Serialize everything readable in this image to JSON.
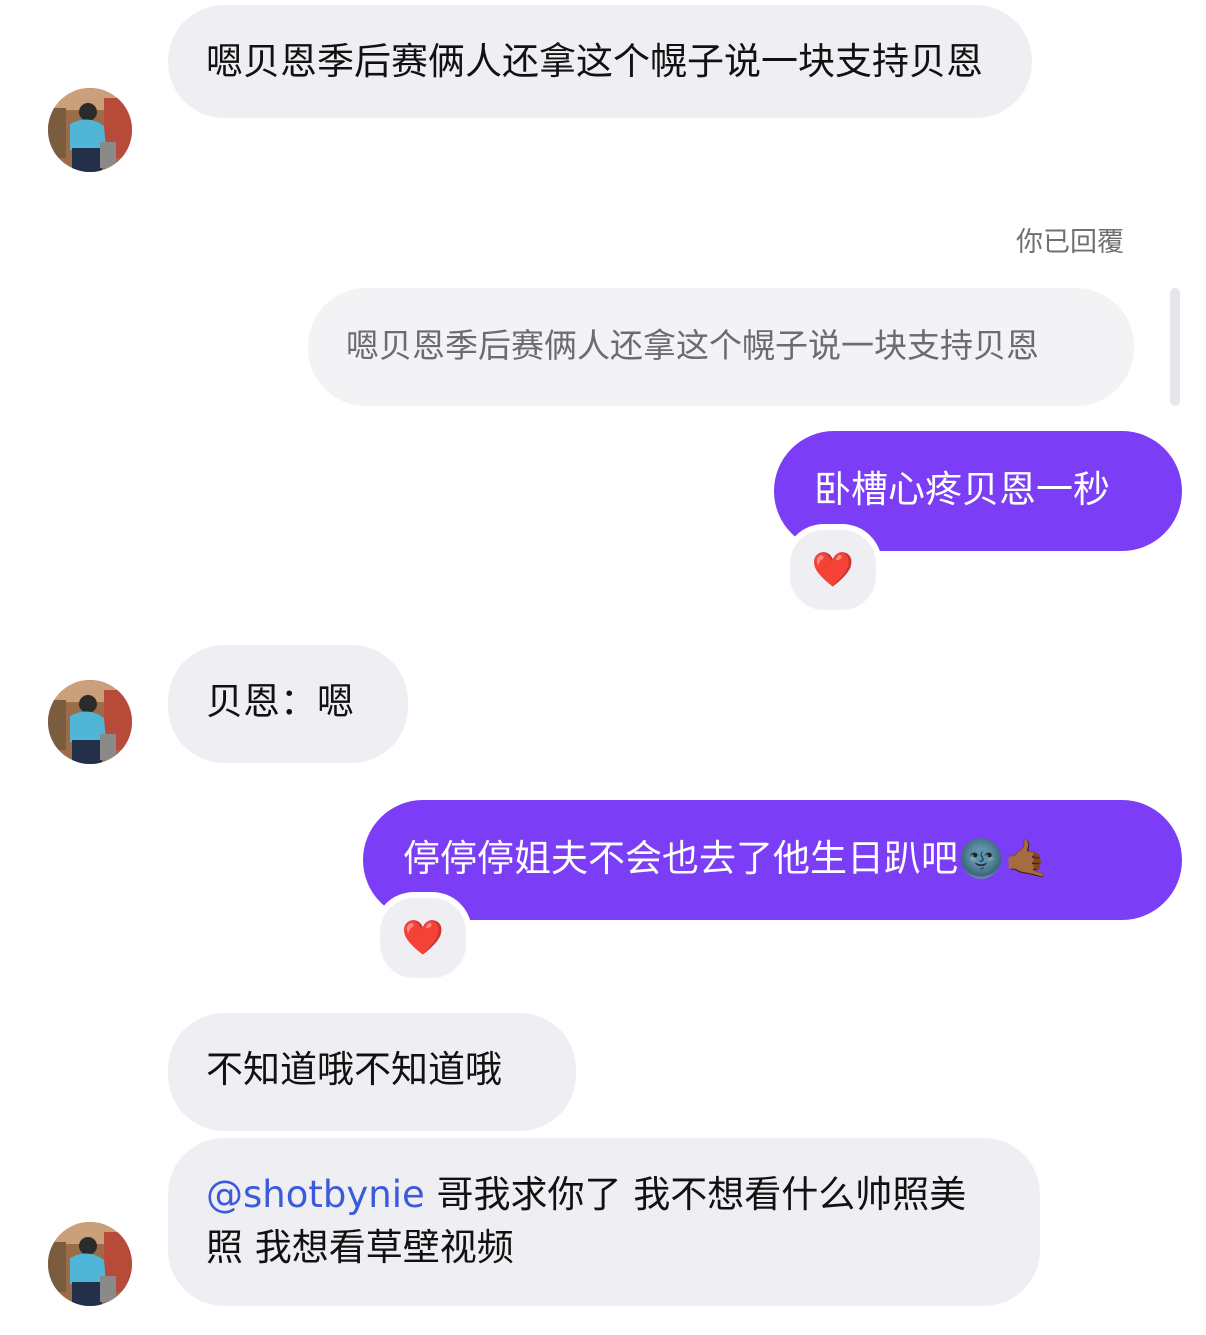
{
  "messages": {
    "m1": {
      "text": "嗯贝恩季后赛俩人还拿这个幌子说一块支持贝恩"
    },
    "reply_status": "你已回覆",
    "quoted": {
      "text": "嗯贝恩季后赛俩人还拿这个幌子说一块支持贝恩"
    },
    "m2": {
      "text": "卧槽心疼贝恩一秒",
      "reaction": "❤️"
    },
    "m3": {
      "text": "贝恩：嗯"
    },
    "m4": {
      "text": "停停停姐夫不会也去了他生日趴吧",
      "emoji": "🌚🤙🏾",
      "reaction": "❤️"
    },
    "m5": {
      "text": "不知道哦不知道哦"
    },
    "m6": {
      "mention": "@shotbynie",
      "text": " 哥我求你了 我不想看什么帅照美照 我想看草壁视频"
    }
  },
  "icons": {
    "avatar": "avatar-person-in-blue-jacket",
    "reaction": "red-heart-icon"
  },
  "colors": {
    "incoming_bubble": "#efeff3",
    "outgoing_bubble": "#7b3ef6",
    "mention": "#3b5bdb"
  }
}
